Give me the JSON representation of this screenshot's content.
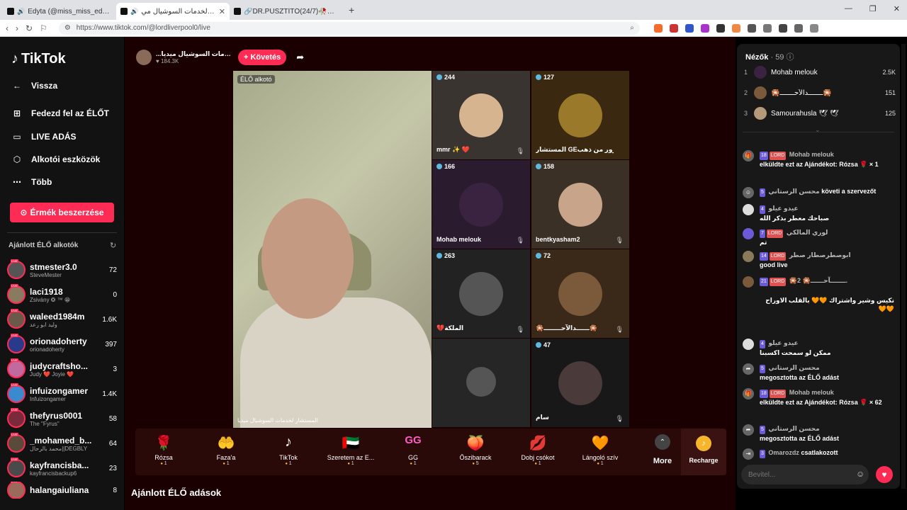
{
  "browser": {
    "tabs": [
      {
        "label": "Edyta (@miss_miss_edyta) ÉLŐ ad",
        "active": false
      },
      {
        "label": "المستشار لخدمات السوشيال مي",
        "active": true
      },
      {
        "label": "🔗DR.PUSZTÍTÓ(24/7)🥀🪄💚💫",
        "active": false
      }
    ],
    "url": "https://www.tiktok.com/@lordliverpool0/live"
  },
  "sidebar": {
    "logo": "TikTok",
    "nav": [
      {
        "icon": "arrow-left-icon",
        "label": "Vissza"
      },
      {
        "icon": "compass-icon",
        "label": "Fedezd fel az ÉLŐT"
      },
      {
        "icon": "camera-icon",
        "label": "LIVE ADÁS"
      },
      {
        "icon": "tools-icon",
        "label": "Alkotói eszközök"
      },
      {
        "icon": "more-dots-icon",
        "label": "Több"
      }
    ],
    "coins_button": "Érmék beszerzése",
    "recommended_title": "Ajánlott ÉLŐ alkotók",
    "creators": [
      {
        "name": "stmester3.0",
        "sub": "SteveMester",
        "viewers": "72"
      },
      {
        "name": "laci1918",
        "sub": "Zsivány ❂ ™ 😁",
        "viewers": "0"
      },
      {
        "name": "waleed1984m",
        "sub": "وليد ابو رعد",
        "viewers": "1.6K"
      },
      {
        "name": "orionadoherty",
        "sub": "orionadoherty",
        "viewers": "397"
      },
      {
        "name": "judycraftsho...",
        "sub": "Judy ❤️ Joyie ❤️",
        "viewers": "3"
      },
      {
        "name": "infuizongamer",
        "sub": "Infuizongamer",
        "viewers": "1.4K"
      },
      {
        "name": "thefyrus0001",
        "sub": "The \"Fyrus\"",
        "viewers": "58"
      },
      {
        "name": "_mohamed_b...",
        "sub": "محمد بالرحال||DEGBLY",
        "viewers": "64"
      },
      {
        "name": "kayfrancisba...",
        "sub": "kayfrancisbackup6",
        "viewers": "23"
      },
      {
        "name": "halangaiuliana",
        "sub": "",
        "viewers": "8"
      }
    ]
  },
  "host": {
    "name": "...شار لخدمات السوشيال ميديا",
    "likes": "184.3K",
    "follow": "+ Követés"
  },
  "video": {
    "label": "ÉLŐ alkotó",
    "caption": "المستشار لخدمات السوشيال ميديا"
  },
  "guests": [
    {
      "count": "244",
      "name": "mmr ✨ ❤️"
    },
    {
      "count": "127",
      "name": "المستشار GEسرور من ذهب"
    },
    {
      "count": "166",
      "name": "Mohab melouk"
    },
    {
      "count": "158",
      "name": "bentkyasham2"
    },
    {
      "count": "263",
      "name": "💔الملكة"
    },
    {
      "count": "72",
      "name": "🎇ــــــدالآحــــــــ🎇"
    },
    {
      "count": "",
      "name": ""
    },
    {
      "count": "47",
      "name": "سام"
    }
  ],
  "gifts": [
    {
      "icon": "🌹",
      "name": "Rózsa",
      "price": "1"
    },
    {
      "icon": "🤲",
      "name": "Faza'a",
      "price": "1"
    },
    {
      "icon": "♪",
      "name": "TikTok",
      "price": "1"
    },
    {
      "icon": "🇦🇪",
      "name": "Szeretem az E...",
      "price": "1"
    },
    {
      "icon": "GG",
      "name": "GG",
      "price": "1"
    },
    {
      "icon": "🍑",
      "name": "Őszibarack",
      "price": "5"
    },
    {
      "icon": "💋",
      "name": "Dobj csókot",
      "price": "1"
    },
    {
      "icon": "🧡",
      "name": "Lángoló szív",
      "price": "1"
    }
  ],
  "gift_more": "More",
  "recharge": "Recharge",
  "recommended_live": "Ajánlott ÉLŐ adások",
  "chat": {
    "viewers_label": "Nézők",
    "viewers_count": "· 59",
    "top": [
      {
        "rank": "1",
        "name": "Mohab melouk",
        "points": "2.5K"
      },
      {
        "rank": "2",
        "name": "🎇ـــــــدالآحـــــــ🎇",
        "points": "151"
      },
      {
        "rank": "3",
        "name": "Samourahusla 🕊 🕊",
        "points": "125"
      }
    ],
    "messages": [
      {
        "level": "18",
        "lord": "LORD",
        "user": "Mohab melouk",
        "text": "elküldte ezt az Ajándékot: Rózsa 🌹 × 1"
      },
      {
        "level": "5",
        "lord": "",
        "user": "محسن الرستاني",
        "text": "követi a szervezőt"
      },
      {
        "level": "4",
        "lord": "",
        "user": "عيدو عيلو",
        "text": "صباحك معطر بذكر الله"
      },
      {
        "level": "7",
        "lord": "LORD",
        "user": "لوري المالكي",
        "text": "تم"
      },
      {
        "level": "14",
        "lord": "LORD",
        "user": "ابوصطرصطار صطر",
        "text": "good live"
      },
      {
        "level": "21",
        "lord": "LORD",
        "user": "🎇ـــــــآحــــــ🎇 2.",
        "text": "نكيس وشير واشتراك 🧡🧡 بالقلب الاوراح 🧡🧡"
      },
      {
        "level": "4",
        "lord": "",
        "user": "عيدو عيلو",
        "text": "ممكن لو سمحت اكسبنا"
      },
      {
        "level": "5",
        "lord": "",
        "user": "محسن الرستاني",
        "text": "megosztotta az ÉLŐ adást"
      },
      {
        "level": "18",
        "lord": "LORD",
        "user": "Mohab melouk",
        "text": "elküldte ezt az Ajándékot: Rózsa 🌹 × 62"
      },
      {
        "level": "5",
        "lord": "",
        "user": "محسن الرستاني",
        "text": "megosztotta az ÉLŐ adást"
      },
      {
        "level": "3",
        "lord": "",
        "user": "Omarozdz",
        "text": "csatlakozott"
      }
    ],
    "input_placeholder": "Bevitel..."
  },
  "colors": {
    "accent": "#fe2c55",
    "coin": "#f6b62b"
  }
}
